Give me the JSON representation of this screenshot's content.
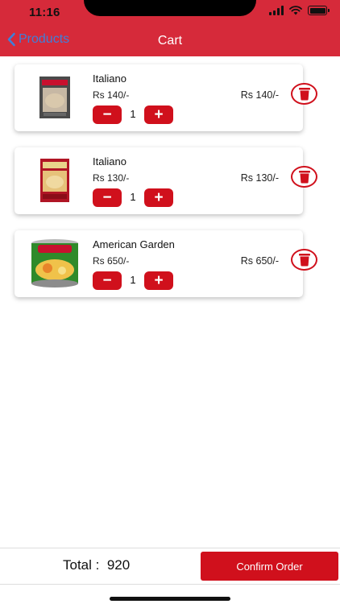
{
  "status_bar": {
    "time": "11:16"
  },
  "nav": {
    "back_label": "Products",
    "title": "Cart"
  },
  "cart": {
    "items": [
      {
        "name": "Italiano",
        "unit_price": "Rs 140/-",
        "quantity": "1",
        "subtotal": "Rs 140/-",
        "image": "product-box-pasta"
      },
      {
        "name": "Italiano",
        "unit_price": "Rs 130/-",
        "quantity": "1",
        "subtotal": "Rs 130/-",
        "image": "product-box-red"
      },
      {
        "name": "American Garden",
        "unit_price": "Rs 650/-",
        "quantity": "1",
        "subtotal": "Rs 650/-",
        "image": "fruit-cocktail-can"
      }
    ],
    "minus_label": "−",
    "plus_label": "+"
  },
  "footer": {
    "total_label": "Total :",
    "total_value": "920",
    "confirm_label": "Confirm Order"
  },
  "colors": {
    "header": "#d62a3a",
    "accent": "#d0101c",
    "back_link": "#3f7fd9"
  },
  "icons": [
    "wifi-icon",
    "battery-icon",
    "signal-icon",
    "chevron-left-icon",
    "trash-icon"
  ]
}
